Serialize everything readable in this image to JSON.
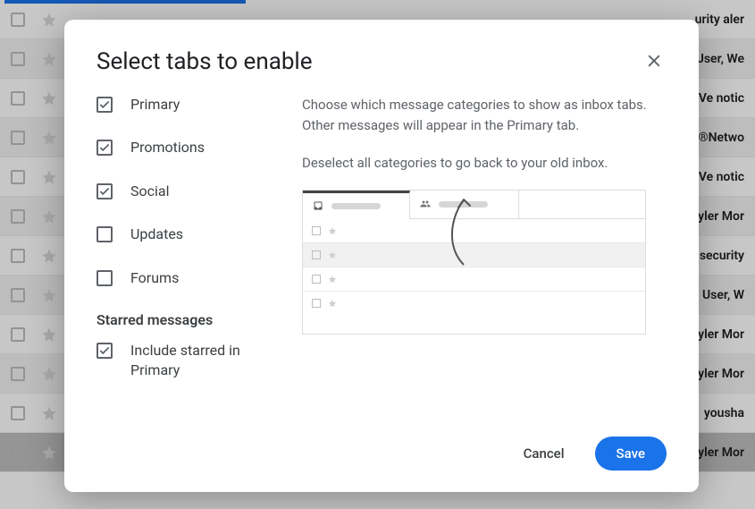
{
  "dialog": {
    "title": "Select tabs to enable",
    "description1": "Choose which message categories to show as inbox tabs. Other messages will appear in the Primary tab.",
    "description2": "Deselect all categories to go back to your old inbox.",
    "categories": [
      {
        "label": "Primary",
        "checked": true
      },
      {
        "label": "Promotions",
        "checked": true
      },
      {
        "label": "Social",
        "checked": true
      },
      {
        "label": "Updates",
        "checked": false
      },
      {
        "label": "Forums",
        "checked": false
      }
    ],
    "starred_heading": "Starred messages",
    "starred_option": {
      "label": "Include starred in Primary",
      "checked": true
    },
    "cancel_label": "Cancel",
    "save_label": "Save"
  },
  "background_rows": [
    {
      "shade": "plain",
      "snippet": "urity aler"
    },
    {
      "shade": "alt",
      "snippet": "Jser, We"
    },
    {
      "shade": "plain",
      "snippet": "Ve notic"
    },
    {
      "shade": "alt",
      "snippet": "®Netwo"
    },
    {
      "shade": "plain",
      "snippet": "Ve notic"
    },
    {
      "shade": "alt",
      "snippet": "yler Mor"
    },
    {
      "shade": "plain",
      "snippet": "security"
    },
    {
      "shade": "alt",
      "snippet": "User, W"
    },
    {
      "shade": "plain",
      "snippet": "yler Mor"
    },
    {
      "shade": "alt",
      "snippet": "yler Mor"
    },
    {
      "shade": "plain",
      "snippet": "yousha"
    },
    {
      "shade": "dark",
      "snippet": "yler Mor"
    }
  ]
}
